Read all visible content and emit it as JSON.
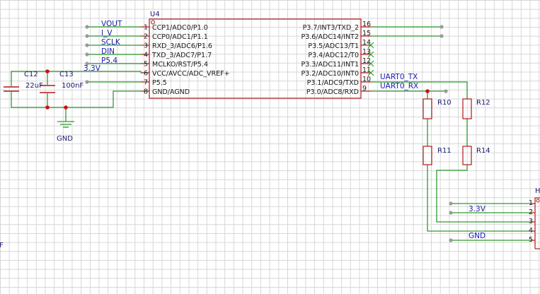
{
  "u4": {
    "ref": "U4",
    "left_pins": [
      {
        "num": "1",
        "name": "CCP1/ADC0/P1.0",
        "net": "VOUT"
      },
      {
        "num": "2",
        "name": "CCP0/ADC1/P1.1",
        "net": "I_V"
      },
      {
        "num": "3",
        "name": "RXD_3/ADC6/P1.6",
        "net": "SCLK"
      },
      {
        "num": "4",
        "name": "TXD_3/ADC7/P1.7",
        "net": "DIN"
      },
      {
        "num": "5",
        "name": "MCLKO/RST/P5.4",
        "net": "P5.4"
      },
      {
        "num": "6",
        "name": "VCC/AVCC/ADC_VREF+",
        "net": "3.3V"
      },
      {
        "num": "7",
        "name": "P5.5",
        "net": ""
      },
      {
        "num": "8",
        "name": "GND/AGND",
        "net": ""
      }
    ],
    "right_pins": [
      {
        "num": "16",
        "name": "P3.7/INT3/TXD_2"
      },
      {
        "num": "15",
        "name": "P3.6/ADC14/INT2"
      },
      {
        "num": "14",
        "name": "P3.5/ADC13/T1"
      },
      {
        "num": "13",
        "name": "P3.4/ADC12/T0"
      },
      {
        "num": "12",
        "name": "P3.3/ADC11/INT1"
      },
      {
        "num": "11",
        "name": "P3.2/ADC10/INT0"
      },
      {
        "num": "10",
        "name": "P3.1/ADC9/TXD"
      },
      {
        "num": "9",
        "name": "P3.0/ADC8/RXD"
      }
    ]
  },
  "capacitors": [
    {
      "ref": "C12",
      "value": "22uF"
    },
    {
      "ref": "C13",
      "value": "100nF"
    }
  ],
  "resistors": [
    {
      "ref": "R10"
    },
    {
      "ref": "R11"
    },
    {
      "ref": "R12"
    },
    {
      "ref": "R14"
    }
  ],
  "nets": {
    "gnd": "GND",
    "uart_tx": "UART0_TX",
    "uart_rx": "UART0_RX"
  },
  "connector": {
    "ref": "H",
    "pins": [
      "1",
      "2",
      "3",
      "4",
      "5"
    ],
    "net_labels": {
      "pin2": "3.3V",
      "pin5": "GND"
    }
  },
  "left_edge_fragment": "F"
}
